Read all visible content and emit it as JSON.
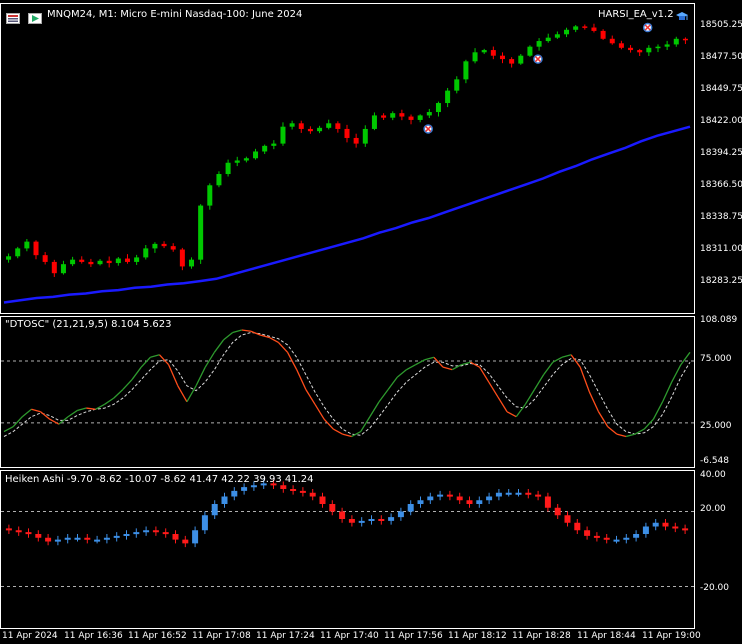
{
  "header": {
    "symbol_line": "MNQM24, M1:  Micro E-mini Nasdaq-100: June 2024",
    "ea_name": "HARSI_EA_v1.2"
  },
  "indicators": {
    "dtosc_label": "\"DTOSC\" (21,21,9,5) 8.104 5.623",
    "heiken_label": "Heiken Ashi -9.70 -8.62 -10.07 -8.62 41.47 42.22 39.93 41.24"
  },
  "colors": {
    "bull": "#00c800",
    "bear": "#ff0000",
    "ma": "#1a1aff",
    "osc_fast": "#2e9a2e",
    "osc_fast_down": "#ff4d1a",
    "ha_bull": "#3d8fe6",
    "ha_bear": "#ff1a1a",
    "grid_dash": "#b0b0b0",
    "panel_border": "#ffffff"
  },
  "icons": {
    "menu": "menu-icon",
    "play": "play-icon",
    "ea": "graduation-cap-icon",
    "trade_marker": "trade-marker-icon"
  },
  "chart_data": [
    {
      "type": "candlestick",
      "name": "price",
      "yticks": [
        "18505.25",
        "18477.50",
        "18449.75",
        "18422.00",
        "18394.25",
        "18366.50",
        "18338.75",
        "18311.00",
        "18283.25"
      ],
      "ylim": [
        18260,
        18520
      ],
      "close": [
        18305,
        18312,
        18318,
        18306,
        18300,
        18290,
        18298,
        18302,
        18300,
        18298,
        18301,
        18299,
        18303,
        18300,
        18304,
        18312,
        18316,
        18314,
        18311,
        18296,
        18302,
        18350,
        18368,
        18378,
        18388,
        18390,
        18392,
        18398,
        18403,
        18405,
        18420,
        18423,
        18418,
        18416,
        18419,
        18423,
        18418,
        18410,
        18405,
        18418,
        18430,
        18428,
        18432,
        18429,
        18426,
        18430,
        18433,
        18441,
        18452,
        18462,
        18478,
        18486,
        18488,
        18483,
        18480,
        18476,
        18483,
        18491,
        18496,
        18499,
        18502,
        18506,
        18509,
        18508,
        18505,
        18498,
        18494,
        18490,
        18488,
        18486,
        18490,
        18491,
        18493,
        18498,
        18497
      ],
      "ma": [
        18264,
        18266,
        18268,
        18269,
        18271,
        18272,
        18274,
        18275,
        18277,
        18278,
        18280,
        18281,
        18283,
        18285,
        18289,
        18293,
        18297,
        18301,
        18305,
        18309,
        18313,
        18317,
        18321,
        18326,
        18330,
        18335,
        18339,
        18344,
        18349,
        18354,
        18359,
        18364,
        18369,
        18374,
        18380,
        18385,
        18391,
        18396,
        18401,
        18407,
        18412,
        18416,
        18420
      ],
      "trade_markers": [
        18418,
        18480,
        18508
      ]
    },
    {
      "type": "line",
      "name": "DTOSC",
      "yticks": [
        "108.089",
        "75.000",
        "25.000",
        "-6.548"
      ],
      "ylim": [
        -6.548,
        108.089
      ],
      "levels": [
        75,
        25
      ],
      "series": [
        {
          "values": [
            18,
            22,
            30,
            36,
            34,
            28,
            24,
            30,
            35,
            37,
            36,
            40,
            45,
            52,
            60,
            70,
            78,
            80,
            72,
            55,
            42,
            55,
            70,
            82,
            92,
            98,
            100,
            99,
            96,
            94,
            90,
            82,
            68,
            52,
            40,
            28,
            20,
            16,
            14,
            18,
            30,
            42,
            52,
            62,
            68,
            72,
            76,
            78,
            70,
            68,
            72,
            74,
            70,
            58,
            46,
            34,
            30,
            40,
            52,
            64,
            74,
            78,
            80,
            70,
            50,
            34,
            22,
            16,
            14,
            16,
            20,
            28,
            42,
            58,
            72,
            82
          ]
        },
        {
          "values": [
            14,
            18,
            24,
            30,
            33,
            31,
            27,
            27,
            31,
            34,
            36,
            37,
            40,
            45,
            52,
            60,
            68,
            75,
            76,
            67,
            55,
            51,
            58,
            68,
            80,
            90,
            96,
            98,
            97,
            95,
            93,
            88,
            78,
            64,
            50,
            38,
            28,
            20,
            16,
            15,
            21,
            30,
            40,
            50,
            58,
            64,
            70,
            74,
            74,
            71,
            71,
            73,
            72,
            65,
            55,
            45,
            38,
            37,
            44,
            54,
            64,
            72,
            77,
            76,
            64,
            50,
            36,
            24,
            18,
            16,
            17,
            22,
            32,
            46,
            62,
            74
          ]
        }
      ]
    },
    {
      "type": "bar",
      "name": "Heiken Ashi",
      "yticks": [
        "40.00",
        "20.00",
        "-20.00"
      ],
      "ylim": [
        -40,
        40
      ],
      "levels": [
        20,
        -20
      ],
      "values": [
        10,
        9,
        8,
        6,
        4,
        5,
        6,
        6,
        5,
        5,
        6,
        7,
        8,
        9,
        10,
        9,
        8,
        5,
        3,
        10,
        18,
        24,
        28,
        31,
        33,
        34,
        35,
        34,
        32,
        31,
        30,
        28,
        24,
        20,
        16,
        14,
        15,
        16,
        15,
        17,
        20,
        24,
        26,
        28,
        29,
        28,
        26,
        24,
        26,
        28,
        30,
        30,
        30,
        29,
        28,
        22,
        18,
        14,
        10,
        7,
        6,
        5,
        5,
        6,
        8,
        12,
        14,
        12,
        11,
        10
      ]
    }
  ],
  "time_axis": {
    "labels": [
      "11 Apr 2024",
      "11 Apr 16:36",
      "11 Apr 16:52",
      "11 Apr 17:08",
      "11 Apr 17:24",
      "11 Apr 17:40",
      "11 Apr 17:56",
      "11 Apr 18:12",
      "11 Apr 18:28",
      "11 Apr 18:44",
      "11 Apr 19:00"
    ]
  }
}
